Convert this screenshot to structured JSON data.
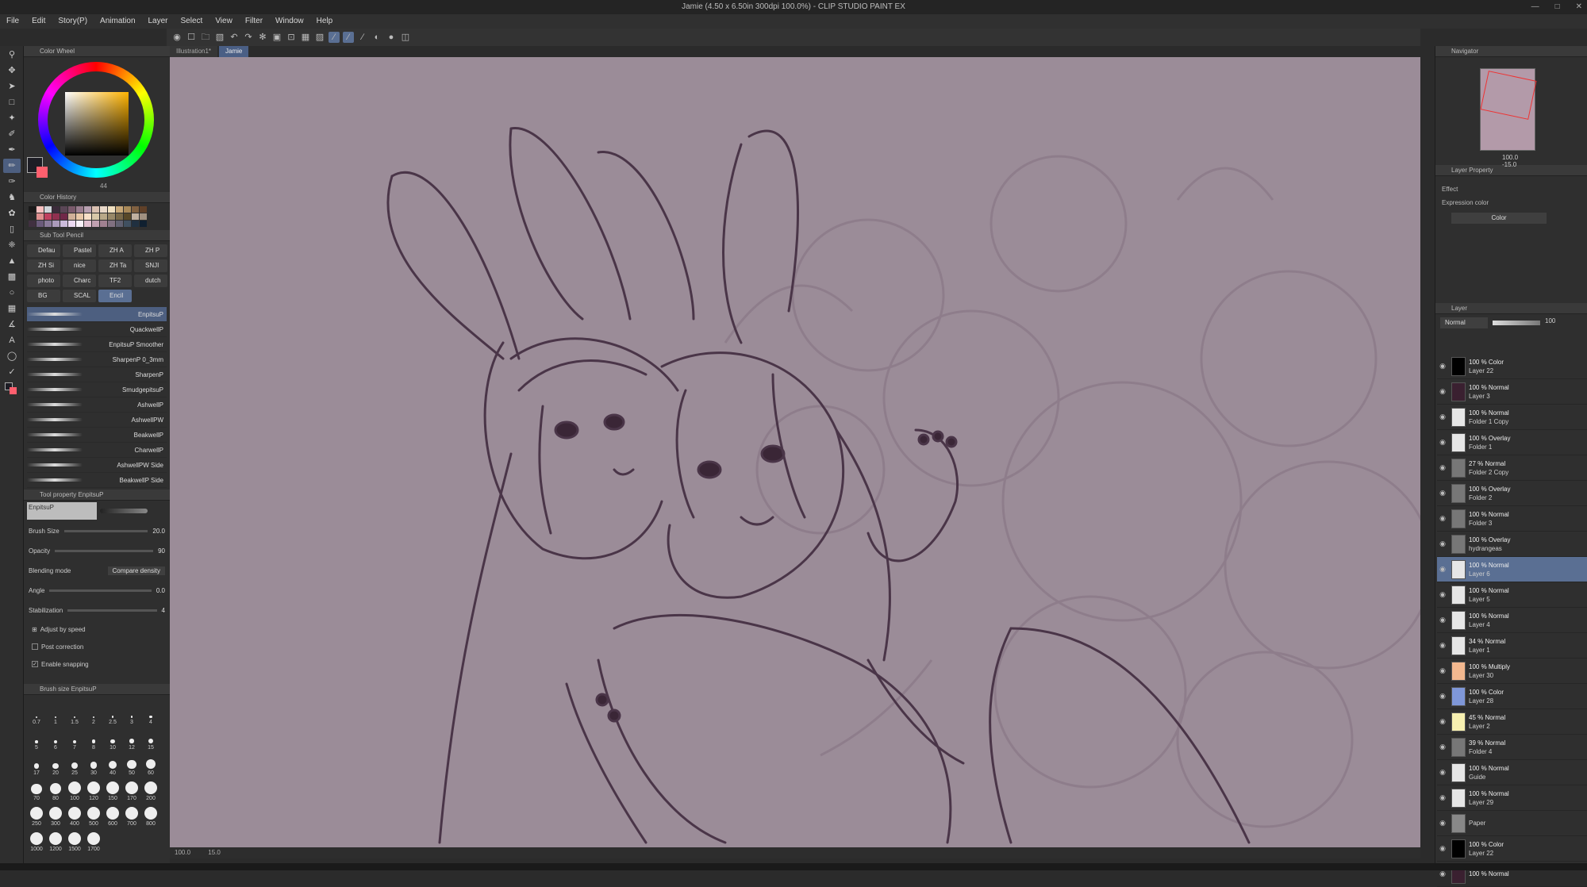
{
  "window": {
    "title": "Jamie (4.50 x 6.50in 300dpi 100.0%) - CLIP STUDIO PAINT EX"
  },
  "menu": [
    "File",
    "Edit",
    "Story(P)",
    "Animation",
    "Layer",
    "Select",
    "View",
    "Filter",
    "Window",
    "Help"
  ],
  "canvas_tabs": [
    "Illustration1*",
    "Jamie"
  ],
  "color_wheel": {
    "title": "Color Wheel",
    "readout": "44",
    "main_color": "#1d1d25",
    "sub_color": "#ff5f6e"
  },
  "color_history": {
    "title": "Color History",
    "swatches": [
      "#1a1a1a",
      "#f7c0c0",
      "#cfd5da",
      "#3b2b3a",
      "#5a4656",
      "#7a5a6c",
      "#9a7d8f",
      "#b8a0b0",
      "#d9c0b0",
      "#e8d8c8",
      "#f0e0c0",
      "#c8a878",
      "#a88858",
      "#806040",
      "#604028",
      "#2a2a2a",
      "#e09090",
      "#c04060",
      "#903050",
      "#702848",
      "#d0b098",
      "#e8c8a8",
      "#f8e0c8",
      "#d8c8a8",
      "#b8a888",
      "#988868",
      "#786848",
      "#584828",
      "#c0b0a0",
      "#a09080",
      "#403040",
      "#6a5a7a",
      "#8a7a9a",
      "#aa9aba",
      "#cabada",
      "#ead8f0",
      "#f8f0f8",
      "#e0c0d0",
      "#c0a0b0",
      "#a08090",
      "#807080",
      "#606070",
      "#405060",
      "#203040",
      "#102030"
    ]
  },
  "sub_tool": {
    "title": "Sub Tool Pencil",
    "tabs": [
      "Defau",
      "Pastel",
      "ZH A",
      "ZH P",
      "ZH Si",
      "nice",
      "ZH Ta",
      "SNJI",
      "photo",
      "Charc",
      "TF2",
      "dutch",
      "BG",
      "SCAL",
      "Encil"
    ],
    "brushes": [
      "EnpitsuP",
      "QuackwellP",
      "EnpitsuP Smoother",
      "SharpenP 0_3mm",
      "SharpenP",
      "SmudgepitsuP",
      "AshwellP",
      "AshwellPW",
      "BeakwellP",
      "CharwellP",
      "AshwellPW Side",
      "BeakwellP Side"
    ]
  },
  "tool_property": {
    "title": "Tool property EnpitsuP",
    "preview_name": "EnpitsuP",
    "brush_size": {
      "label": "Brush Size",
      "value": "20.0"
    },
    "opacity": {
      "label": "Opacity",
      "value": "90"
    },
    "blending_mode": {
      "label": "Blending mode",
      "value": "Compare density"
    },
    "angle": {
      "label": "Angle",
      "value": "0.0"
    },
    "stabilization": {
      "label": "Stabilization",
      "value": "4"
    },
    "adjust_by_speed": "Adjust by speed",
    "post_correction": "Post correction",
    "enable_snapping": "Enable snapping"
  },
  "brush_size_palette": {
    "title": "Brush size EnpitsuP",
    "sizes": [
      "0.7",
      "1",
      "1.5",
      "2",
      "2.5",
      "3",
      "4",
      "5",
      "6",
      "7",
      "8",
      "10",
      "12",
      "15",
      "17",
      "20",
      "25",
      "30",
      "40",
      "50",
      "60",
      "70",
      "80",
      "100",
      "120",
      "150",
      "170",
      "200",
      "250",
      "300",
      "400",
      "500",
      "600",
      "700",
      "800",
      "1000",
      "1200",
      "1500",
      "1700"
    ]
  },
  "navigator": {
    "title": "Navigator",
    "zoom": "100.0",
    "rotation": "-15.0"
  },
  "layer_property": {
    "title": "Layer Property",
    "effect_label": "Effect",
    "expression_label": "Expression color",
    "expression_value": "Color"
  },
  "layer_panel": {
    "title": "Layer",
    "blend_mode": "Normal",
    "opacity": "100",
    "layers": [
      {
        "mode": "100 % Color",
        "name": "Layer 22",
        "thumb": "#000000"
      },
      {
        "mode": "100 % Normal",
        "name": "Layer 3",
        "thumb": "#3a2030"
      },
      {
        "mode": "100 % Normal",
        "name": "Folder 1 Copy",
        "thumb": "#e6e6e6"
      },
      {
        "mode": "100 % Overlay",
        "name": "Folder 1",
        "thumb": "#e6e6e6"
      },
      {
        "mode": "27 % Normal",
        "name": "Folder 2 Copy",
        "thumb": "#777777"
      },
      {
        "mode": "100 % Overlay",
        "name": "Folder 2",
        "thumb": "#777777"
      },
      {
        "mode": "100 % Normal",
        "name": "Folder 3",
        "thumb": "#777777"
      },
      {
        "mode": "100 % Overlay",
        "name": "hydrangeas",
        "thumb": "#777777"
      },
      {
        "mode": "100 % Normal",
        "name": "Layer 6",
        "thumb": "#e6e6e6"
      },
      {
        "mode": "100 % Normal",
        "name": "Layer 5",
        "thumb": "#e6e6e6"
      },
      {
        "mode": "100 % Normal",
        "name": "Layer 4",
        "thumb": "#e6e6e6"
      },
      {
        "mode": "34 % Normal",
        "name": "Layer 1",
        "thumb": "#e6e6e6"
      },
      {
        "mode": "100 % Multiply",
        "name": "Layer 30",
        "thumb": "#f3b88f"
      },
      {
        "mode": "100 % Color",
        "name": "Layer 28",
        "thumb": "#7f97d8"
      },
      {
        "mode": "45 % Normal",
        "name": "Layer 2",
        "thumb": "#f7f0b0"
      },
      {
        "mode": "39 % Normal",
        "name": "Folder 4",
        "thumb": "#777777"
      },
      {
        "mode": "100 % Normal",
        "name": "Guide",
        "thumb": "#e6e6e6"
      },
      {
        "mode": "100 % Normal",
        "name": "Layer 29",
        "thumb": "#e6e6e6"
      },
      {
        "mode": "",
        "name": "Paper",
        "thumb": "#888888"
      },
      {
        "mode": "100 % Color",
        "name": "Layer 22",
        "thumb": "#000000"
      },
      {
        "mode": "100 % Normal",
        "name": "",
        "thumb": "#3a2030"
      }
    ]
  },
  "status": {
    "zoom": "100.0",
    "angle": "15.0"
  }
}
